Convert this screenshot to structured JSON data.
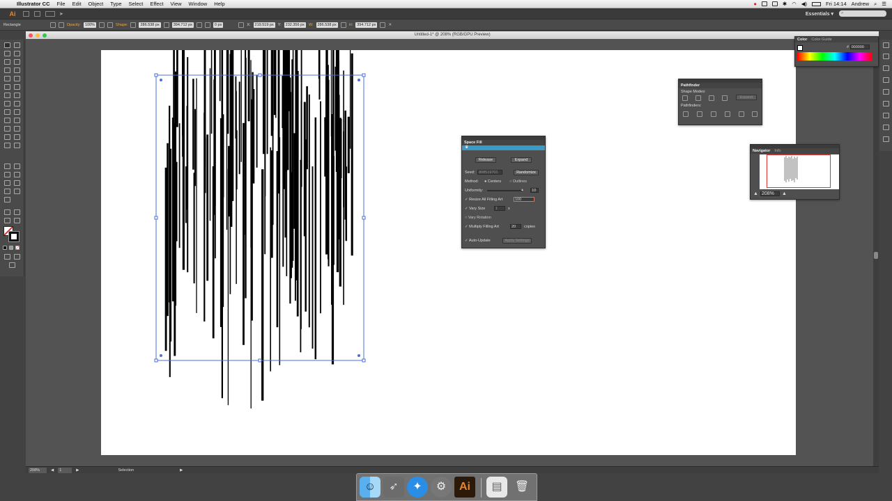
{
  "menubar": {
    "app_name": "Illustrator CC",
    "menus": [
      "File",
      "Edit",
      "Object",
      "Type",
      "Select",
      "Effect",
      "View",
      "Window",
      "Help"
    ],
    "clock": "Fri 14:14",
    "user": "Andrew"
  },
  "appbar": {
    "logo": "Ai",
    "workspace": "Essentials",
    "workspace_arrow": "▾"
  },
  "control": {
    "tool_name": "Rectangle",
    "opacity_label": "Opacity:",
    "opacity_value": "100%",
    "shape_label": "Shape:",
    "shape_w": "286.538 px",
    "shape_h": "394.712 px",
    "corner": "0 px",
    "x_label": "X:",
    "x_value": "219.519 px",
    "y_label": "Y:",
    "y_value": "232.356 px",
    "w_label": "W:",
    "w_value": "286.538 px",
    "h_label": "H:",
    "h_value": "394.712 px"
  },
  "document": {
    "title": "Untitled-1* @ 208% (RGB/GPU Preview)"
  },
  "color_panel": {
    "tab1": "Color",
    "tab2": "Color Guide",
    "hex_prefix": "#",
    "hex": "000000"
  },
  "pathfinder_panel": {
    "title": "Pathfinder",
    "shape_modes": "Shape Modes:",
    "expand": "Expand",
    "pathfinders": "Pathfinders:"
  },
  "space_fill": {
    "title": "Space Fill",
    "release": "Release",
    "expand": "Expand",
    "seed_label": "Seed:",
    "seed_value": "808519701",
    "randomize": "Randomize",
    "method_label": "Method:",
    "centers": "Centers",
    "outlines": "Outlines",
    "uniformity_label": "Uniformity:",
    "uniformity_value": "10",
    "resize_label": "Resize All Filling Art",
    "resize_value": "100",
    "vary_size": "Vary Size",
    "vary_size_value": "1",
    "vary_size_unit": "x",
    "vary_rotation": "Vary Rotation",
    "multiply": "Multiply Filling Art",
    "multiply_value": "20",
    "copies": "copies",
    "auto_update": "Auto-Update",
    "apply": "Apply Settings"
  },
  "navigator": {
    "tab1": "Navigator",
    "tab2": "Info",
    "zoom": "208%"
  },
  "status": {
    "zoom": "208%",
    "artboard": "1",
    "tool": "Selection"
  },
  "colors": {
    "accent": "#e8852a",
    "panel_bg": "#4f4f4f",
    "selection": "#4a6fd8",
    "spacefill_header": "#3a9bc6"
  }
}
